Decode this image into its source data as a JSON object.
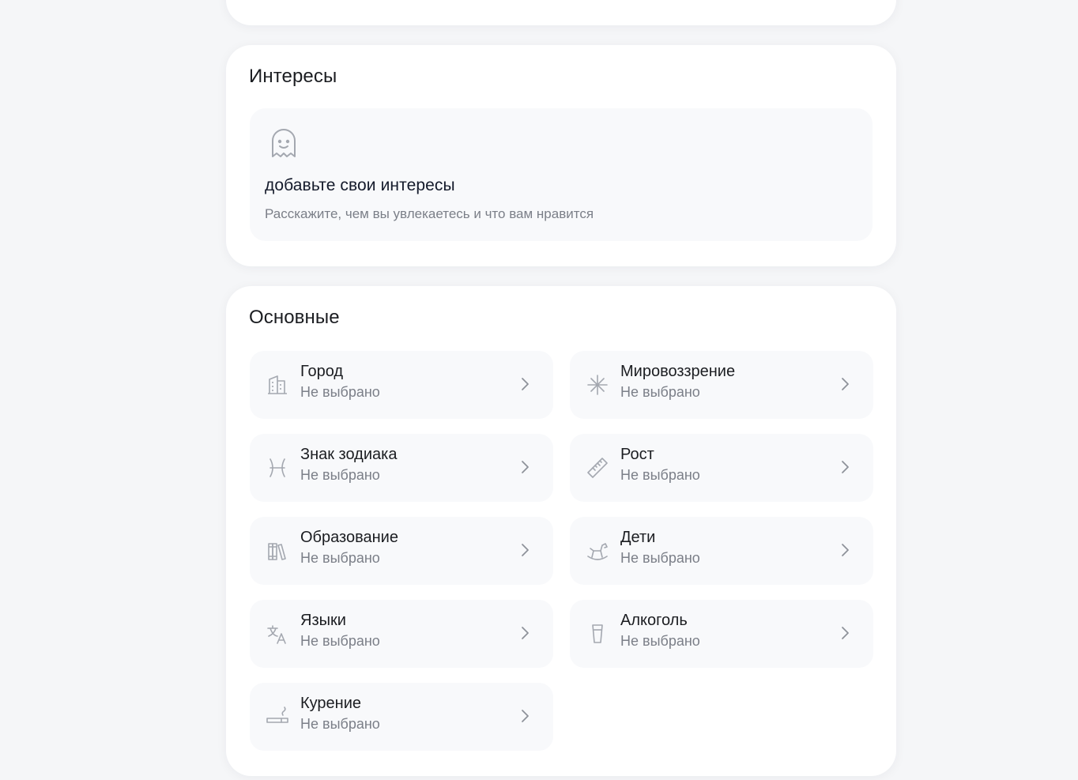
{
  "interests": {
    "title": "Интересы",
    "empty": {
      "icon": "ghost-icon",
      "title": "добавьте свои интересы",
      "subtitle": "Расскажите, чем вы увлекаетесь и что вам нравится"
    }
  },
  "basic": {
    "title": "Основные",
    "items": [
      {
        "label": "Город",
        "value": "Не выбрано",
        "icon": "building-icon"
      },
      {
        "label": "Мировоззрение",
        "value": "Не выбрано",
        "icon": "sparkle-icon"
      },
      {
        "label": "Знак зодиака",
        "value": "Не выбрано",
        "icon": "pisces-icon"
      },
      {
        "label": "Рост",
        "value": "Не выбрано",
        "icon": "ruler-icon"
      },
      {
        "label": "Образование",
        "value": "Не выбрано",
        "icon": "books-icon"
      },
      {
        "label": "Дети",
        "value": "Не выбрано",
        "icon": "rocking-horse-icon"
      },
      {
        "label": "Языки",
        "value": "Не выбрано",
        "icon": "translate-icon"
      },
      {
        "label": "Алкоголь",
        "value": "Не выбрано",
        "icon": "glass-icon"
      },
      {
        "label": "Курение",
        "value": "Не выбрано",
        "icon": "cigarette-icon"
      }
    ]
  },
  "colors": {
    "page_bg": "#f5f6f8",
    "card_bg": "#ffffff",
    "tile_bg": "#f8f9fb",
    "text_primary": "#1b1d21",
    "text_secondary": "#7b7f88",
    "icon": "#a4a8b0"
  }
}
